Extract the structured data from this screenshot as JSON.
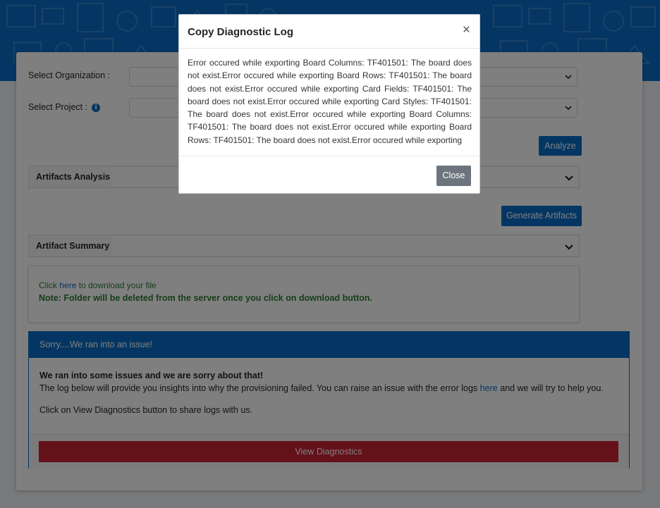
{
  "form": {
    "organization_label": "Select Organization :",
    "project_label": "Select Project :",
    "info_glyph": "i",
    "analyze_label": "Analyze",
    "generate_label": "Generate Artifacts"
  },
  "accordions": {
    "artifacts_analysis": "Artifacts Analysis",
    "artifact_summary": "Artifact Summary"
  },
  "download": {
    "click_text": "Click",
    "here_link": "here",
    "after_link": "to download your file",
    "note": "Note: Folder will be deleted from the server once you click on download button."
  },
  "issue": {
    "header": "Sorry....We ran into an issue!",
    "bold_line": "We ran into some issues and we are sorry about that!",
    "log_text_before": "The log below will provide you insights into why the provisioning failed. You can raise an issue with the error logs",
    "log_link": "here",
    "log_text_after": "and we will try to help you.",
    "share_text": "Click on View Diagnostics button to share logs with us.",
    "view_diagnostics_label": "View Diagnostics"
  },
  "modal": {
    "title": "Copy Diagnostic Log",
    "close_symbol": "×",
    "body": "Error occured while exporting Board Columns: TF401501: The board does not exist.Error occured while exporting Board Rows: TF401501: The board does not exist.Error occured while exporting Card Fields: TF401501: The board does not exist.Error occured while exporting Card Styles: TF401501: The board does not exist.Error occured while exporting Board Columns: TF401501: The board does not exist.Error occured while exporting Board Rows: TF401501: The board does not exist.Error occured while exporting",
    "close_button_label": "Close"
  },
  "colors": {
    "primary": "#0b6cc7",
    "danger": "#c82333",
    "success_text": "#2e7d32",
    "secondary": "#6c757d"
  },
  "icons": [
    "info-icon",
    "chevron-down-icon",
    "close-icon"
  ]
}
